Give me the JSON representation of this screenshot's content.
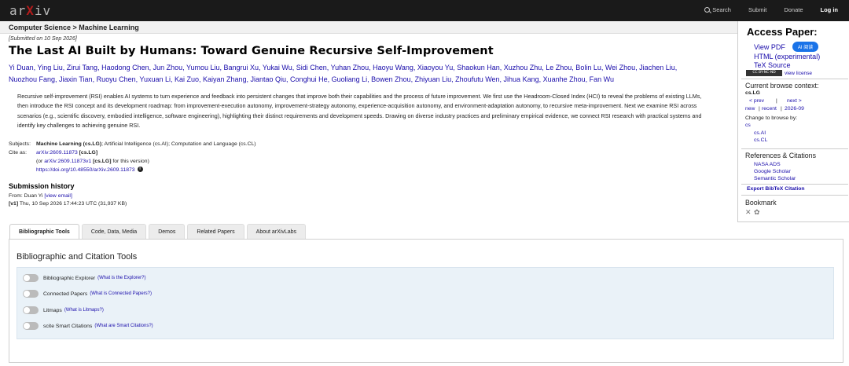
{
  "header": {
    "logo_a": "ar",
    "logo_x": "X",
    "logo_b": "iv",
    "search": "Search",
    "submit": "Submit",
    "donate": "Donate",
    "login": "Log in"
  },
  "breadcrumb": "Computer Science > Machine Learning",
  "paper": {
    "submitted": "[Submitted on 10 Sep 2026]",
    "title": "The Last AI Built by Humans: Toward Genuine Recursive Self-Improvement",
    "authors_line1": "Yi Duan, Ying Liu, Zirui Tang, Haodong Chen, Jun Zhou, Yumou Liu, Bangrui Xu, Yukai Wu, Sidi Chen, Yuhan Zhou, Haoyu Wang, Xiaoyou Yu, Shaokun Han, Xuzhou Zhu, Le Zhou, Bolin Lu, Wei Zhou, Jiachen Liu,",
    "authors_line2": "Nuozhou Fang, Jiaxin Tian, Ruoyu Chen, Yuxuan Li, Kai Zuo, Kaiyan Zhang, Jiantao Qiu, Conghui He, Guoliang Li, Bowen Zhou, Zhiyuan Liu, Zhoufutu Wen, Jihua Kang, Xuanhe Zhou, Fan Wu",
    "abstract": "Recursive self-improvement (RSI) enables AI systems to turn experience and feedback into persistent changes that improve both their capabilities and the process of future improvement. We first use the Headroom-Closed Index (HCI) to reveal the problems of existing LLMs, then introduce the RSI concept and its development roadmap: from improvement-execution autonomy, improvement-strategy autonomy, experience-acquisition autonomy, and environment-adaptation autonomy, to recursive meta-improvement. Next we examine RSI across scenarios (e.g., scientific discovery, embodied intelligence, software engineering), highlighting their distinct requirements and development speeds. Drawing on diverse industry practices and preliminary empirical evidence, we connect RSI research with practical systems and identify key challenges to achieving genuine RSI.",
    "subjects_label": "Subjects:",
    "subjects_main": "Machine Learning (cs.LG)",
    "subjects_rest": "; Artificial Intelligence (cs.AI); Computation and Language (cs.CL)",
    "cite_label": "Cite as:",
    "cite_id": "arXiv:2609.11873",
    "cite_tag": "[cs.LG]",
    "cite_or": "(or ",
    "cite_v1": "arXiv:2609.11873v1",
    "cite_v1_tag": "[cs.LG]",
    "cite_v1_rest": " for this version)",
    "doi": "https://doi.org/10.48550/arXiv.2609.11873",
    "info_icon": "i"
  },
  "history": {
    "heading": "Submission history",
    "from_prefix": "From: Duan Yi ",
    "from_email": "[view email]",
    "version": "[v1]",
    "version_text": " Thu, 10 Sep 2026 17:44:23 UTC (31,937 KB)"
  },
  "tabs": [
    "Bibliographic Tools",
    "Code, Data, Media",
    "Demos",
    "Related Papers",
    "About arXivLabs"
  ],
  "tools": {
    "heading": "Bibliographic and Citation Tools",
    "items": [
      {
        "label": "Bibliographic Explorer",
        "link": "(What is the Explorer?)"
      },
      {
        "label": "Connected Papers",
        "link": "(What is Connected Papers?)"
      },
      {
        "label": "Litmaps",
        "link": "(What is Litmaps?)"
      },
      {
        "label": "scite Smart Citations",
        "link": "(What are Smart Citations?)"
      }
    ]
  },
  "sidebar": {
    "access_heading": "Access Paper:",
    "view_pdf": "View PDF",
    "ai_button": "AI 阅读",
    "html": "HTML (experimental)",
    "tex": "TeX Source",
    "license_badge": "CC BY-NC-ND",
    "license": "view license",
    "browse_heading": "Current browse context:",
    "context": "cs.LG",
    "prev": "< prev",
    "sep": "|",
    "next": "next >",
    "new": "new",
    "recent": "recent",
    "date": "2026-09",
    "change_label": "Change to browse by:",
    "cs": "cs",
    "cs_ai": "cs.AI",
    "cs_cl": "cs.CL",
    "refs_heading": "References & Citations",
    "nasa": "NASA ADS",
    "scholar": "Google Scholar",
    "semantic": "Semantic Scholar",
    "bibtex": "Export BibTeX Citation",
    "bookmark_heading": "Bookmark"
  },
  "colors": {
    "accent": "#b31b1b",
    "link": "#1a0dab",
    "header_bg": "#1a1a1a",
    "ai_button": "#1a73e8"
  }
}
